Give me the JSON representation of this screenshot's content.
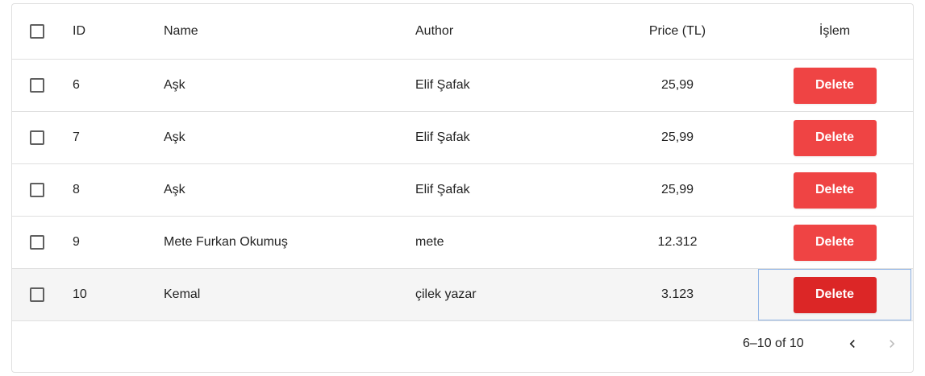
{
  "table": {
    "headers": {
      "id": "ID",
      "name": "Name",
      "author": "Author",
      "price": "Price (TL)",
      "action": "İşlem"
    },
    "rows": [
      {
        "id": "6",
        "name": "Aşk",
        "author": "Elif Şafak",
        "price": "25,99",
        "action": "Delete"
      },
      {
        "id": "7",
        "name": "Aşk",
        "author": "Elif Şafak",
        "price": "25,99",
        "action": "Delete"
      },
      {
        "id": "8",
        "name": "Aşk",
        "author": "Elif Şafak",
        "price": "25,99",
        "action": "Delete"
      },
      {
        "id": "9",
        "name": "Mete Furkan Okumuş",
        "author": "mete",
        "price": "12.312",
        "action": "Delete"
      },
      {
        "id": "10",
        "name": "Kemal",
        "author": "çilek yazar",
        "price": "3.123",
        "action": "Delete"
      }
    ]
  },
  "pagination": {
    "range_text": "6–10 of 10",
    "prev_icon": "chevron-left-icon",
    "next_icon": "chevron-right-icon"
  },
  "colors": {
    "delete_button": "#ef4444",
    "delete_button_hover": "#dc2626",
    "row_hover": "#f5f5f5",
    "border": "#e0e0e0"
  }
}
